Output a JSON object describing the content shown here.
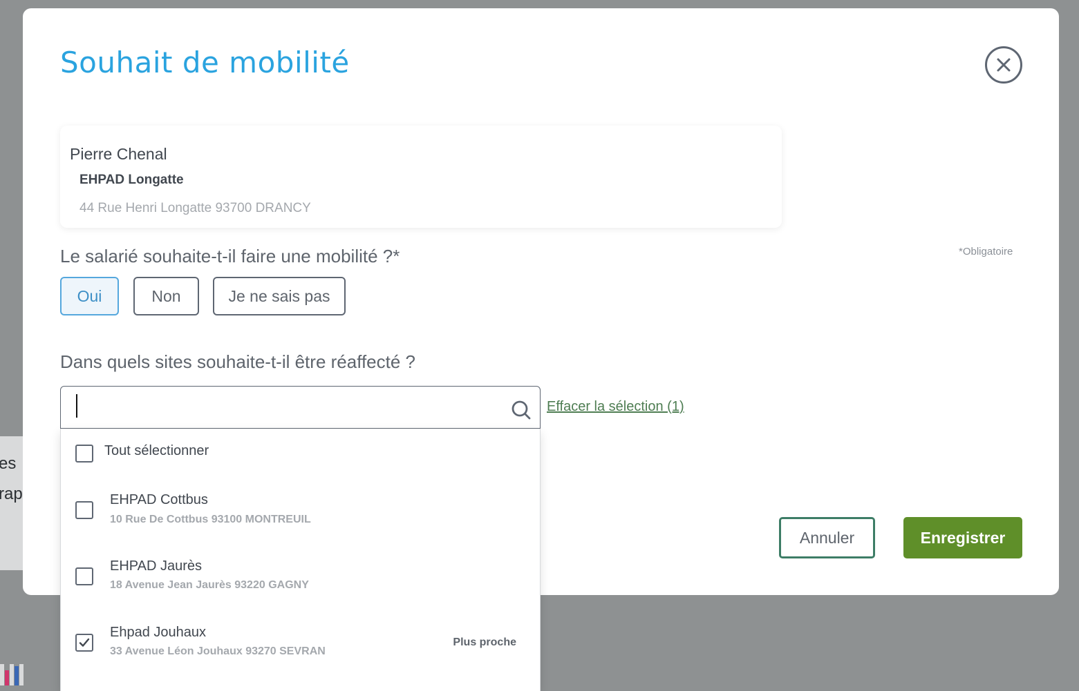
{
  "background": {
    "text_line_1": "es",
    "text_line_2": "rap",
    "bar_colors": [
      "#d9dadb",
      "#d0366c",
      "#d9dadb",
      "#3b68b5",
      "#d9dadb"
    ]
  },
  "modal": {
    "title": "Souhait de mobilité",
    "close_icon": "close-circle-icon"
  },
  "employee": {
    "name": "Pierre Chenal",
    "site": "EHPAD Longatte",
    "address": "44 Rue Henri Longatte 93700 DRANCY"
  },
  "form": {
    "required_note": "*Obligatoire",
    "question_mobility": "Le salarié souhaite-t-il faire une mobilité ?*",
    "choices": [
      {
        "label": "Oui",
        "selected": true
      },
      {
        "label": "Non",
        "selected": false
      },
      {
        "label": "Je ne sais pas",
        "selected": false
      }
    ],
    "question_sites": "Dans quels sites souhaite-t-il être réaffecté ?",
    "search": {
      "value": "",
      "icon": "search-icon"
    },
    "clear_link": "Effacer la sélection (1)"
  },
  "dropdown": {
    "select_all_label": "Tout sélectionner",
    "select_all_checked": false,
    "options": [
      {
        "name": "EHPAD Cottbus",
        "address": "10 Rue De Cottbus 93100 MONTREUIL",
        "checked": false,
        "tag": ""
      },
      {
        "name": "EHPAD Jaurès",
        "address": "18 Avenue Jean Jaurès 93220 GAGNY",
        "checked": false,
        "tag": ""
      },
      {
        "name": "Ehpad Jouhaux",
        "address": "33 Avenue Léon Jouhaux 93270 SEVRAN",
        "checked": true,
        "tag": "Plus proche"
      }
    ]
  },
  "actions": {
    "cancel_label": "Annuler",
    "save_label": "Enregistrer"
  },
  "colors": {
    "title": "#2aa3df",
    "save_button": "#5f8f29",
    "cancel_border": "#3d7d66",
    "link": "#4e7d52",
    "selected_choice": "#55a7dd",
    "overlay": "#8e9192"
  }
}
